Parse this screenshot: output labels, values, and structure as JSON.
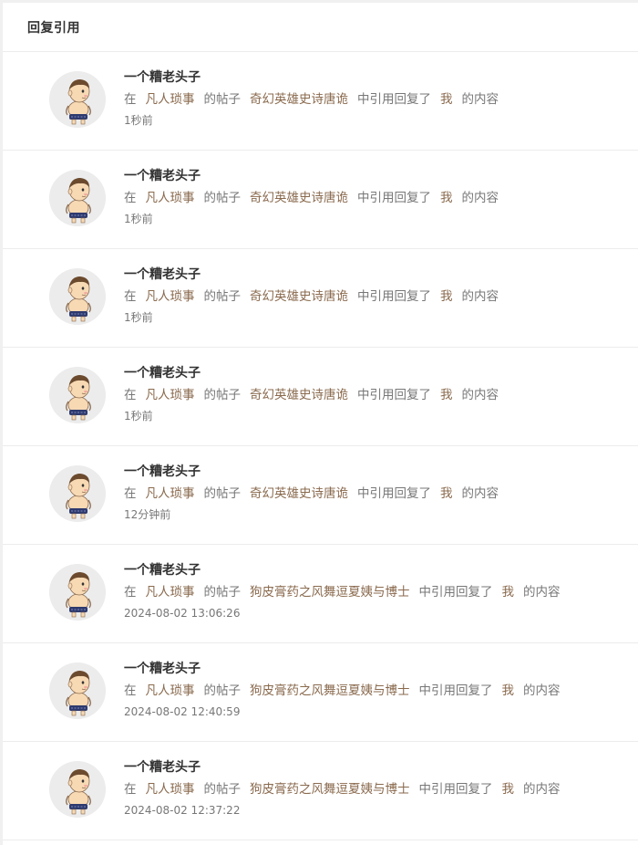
{
  "header": {
    "title": "回复引用"
  },
  "colors": {
    "link": "#8a6a4e",
    "text": "#777777",
    "name": "#333333",
    "divider": "#ececec"
  },
  "labels": {
    "in": "在",
    "post_of": "的帖子",
    "quoted_reply": "中引用回复了",
    "content_of": "的内容"
  },
  "items": [
    {
      "user": "一个糟老头子",
      "forum": "凡人琐事",
      "thread": "奇幻英雄史诗唐诡",
      "target": "我",
      "time": "1秒前",
      "avatar": "cartoon-boy-avatar"
    },
    {
      "user": "一个糟老头子",
      "forum": "凡人琐事",
      "thread": "奇幻英雄史诗唐诡",
      "target": "我",
      "time": "1秒前",
      "avatar": "cartoon-boy-avatar"
    },
    {
      "user": "一个糟老头子",
      "forum": "凡人琐事",
      "thread": "奇幻英雄史诗唐诡",
      "target": "我",
      "time": "1秒前",
      "avatar": "cartoon-boy-avatar"
    },
    {
      "user": "一个糟老头子",
      "forum": "凡人琐事",
      "thread": "奇幻英雄史诗唐诡",
      "target": "我",
      "time": "1秒前",
      "avatar": "cartoon-boy-avatar"
    },
    {
      "user": "一个糟老头子",
      "forum": "凡人琐事",
      "thread": "奇幻英雄史诗唐诡",
      "target": "我",
      "time": "12分钟前",
      "avatar": "cartoon-boy-avatar"
    },
    {
      "user": "一个糟老头子",
      "forum": "凡人琐事",
      "thread": "狗皮膏药之风舞逗夏姨与博士",
      "target": "我",
      "time": "2024-08-02 13:06:26",
      "avatar": "cartoon-boy-avatar"
    },
    {
      "user": "一个糟老头子",
      "forum": "凡人琐事",
      "thread": "狗皮膏药之风舞逗夏姨与博士",
      "target": "我",
      "time": "2024-08-02 12:40:59",
      "avatar": "cartoon-boy-avatar"
    },
    {
      "user": "一个糟老头子",
      "forum": "凡人琐事",
      "thread": "狗皮膏药之风舞逗夏姨与博士",
      "target": "我",
      "time": "2024-08-02 12:37:22",
      "avatar": "cartoon-boy-avatar"
    }
  ]
}
